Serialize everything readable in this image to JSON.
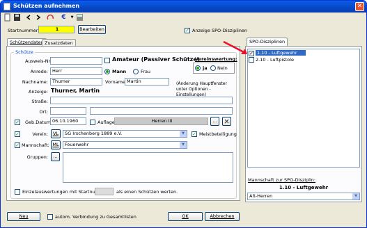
{
  "window": {
    "title": "Schützen aufnehmen",
    "close_glyph": "✕"
  },
  "toolbar": {
    "euro": "€"
  },
  "header": {
    "startnummer_label": "Startnummer:",
    "startnummer_value": "1",
    "bearbeiten_button": "Bearbeiten",
    "spo_checkbox_label": "Anzeige SPO-Disziplinen"
  },
  "tabs": {
    "schuetzendaten": "Schützendaten",
    "zusatzdaten": "Zusatzdaten",
    "spo": "SPO-Disziplinen"
  },
  "schuetze": {
    "group_label": "Schütze",
    "ausweis_label": "Ausweis-Nr.:",
    "ausweis_value": "",
    "amateur_label": "Amateur (Passiver Schütze)",
    "verein_label": "Vereinswertung:",
    "ja_label": "ja",
    "nein_label": "Nein",
    "anrede_label": "Anrede:",
    "anrede_value": "Herr",
    "mann_label": "Mann",
    "frau_label": "Frau",
    "nachname_label": "Nachname:",
    "nachname_value": "Thurner",
    "vorname_label": "Vorname:",
    "vorname_value": "Martin",
    "anzeige_label": "Anzeige:",
    "anzeige_value": "Thurner, Martin",
    "hint": "(Änderung Hauptfenster unter Optionen - Einstellungen)",
    "strasse_label": "Straße:",
    "ort_label": "Ort:",
    "gebdatum_label": "Geb.Datum:",
    "gebdatum_value": "06.10.1960",
    "auflage_label": "Auflage",
    "klasse_value": "Herren III",
    "verein_field_label": "Verein:",
    "vl_button": "VL",
    "verein_value": "SG Irschenberg 1889 e.V.",
    "meistbeteiligung_label": "Meistbeteiligung",
    "mannschaft_label": "Mannschaft:",
    "ml_button": "ML",
    "mannschaft_value": "Feuerwehr",
    "gruppen_label": "Gruppen:",
    "gruppen_button": "...",
    "dots_button": "...",
    "einzel_label_1": "Einzelauswertungen mit Startnummer",
    "einzel_label_2": "als einen Schützen werten."
  },
  "spo": {
    "items": [
      {
        "label": "1.10 - Luftgewehr",
        "checked": true,
        "selected": true
      },
      {
        "label": "2.10 - Luftpistole",
        "checked": false,
        "selected": false
      }
    ],
    "mannschaft_label": "Mannschaft zur SPO-Disziplin:",
    "discipline_title": "1.10 - Luftgewehr",
    "mannschaft_value": "Alt-Herren"
  },
  "footer": {
    "neu": "Neu",
    "auto_label": "autom. Verbindung zu Gesamtlisten",
    "ok": "OK",
    "abbrechen": "Abbrechen"
  },
  "colors": {
    "startnummer_bg": "#ffff00",
    "arrow": "#e8102a"
  }
}
